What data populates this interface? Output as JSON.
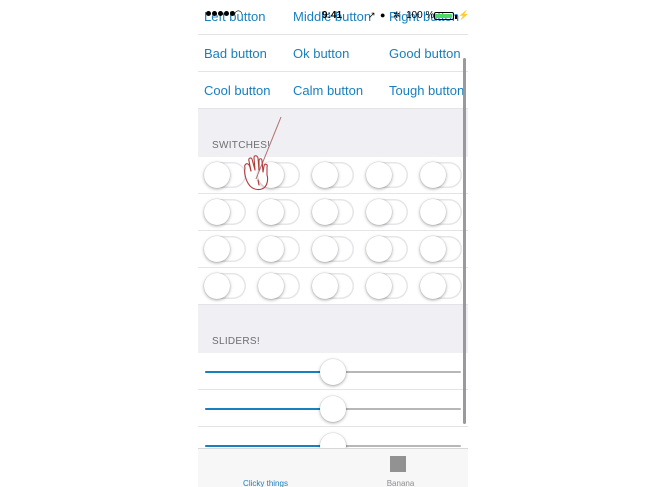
{
  "status_bar": {
    "time": "9:41",
    "battery_percent": "100 %",
    "battery_level": 1.0
  },
  "button_rows": [
    [
      "Left button",
      "Middle button",
      "Right button"
    ],
    [
      "Bad button",
      "Ok button",
      "Good button"
    ],
    [
      "Cool button",
      "Calm button",
      "Tough button"
    ]
  ],
  "switches": {
    "header": "SWITCHES!",
    "rows": 4,
    "columns": 5,
    "all_on": false
  },
  "sliders": {
    "header": "SLIDERS!",
    "values": [
      0.5,
      0.5,
      0.5
    ],
    "accent_color": "#1a7fbd"
  },
  "tab_bar": {
    "tabs": [
      {
        "label": "Clicky things",
        "selected": true
      },
      {
        "label": "Banana",
        "selected": false
      }
    ]
  },
  "colors": {
    "tint": "#1a7fbd",
    "group_background": "#efeff4",
    "separator": "#e3e3e8"
  },
  "icons": [
    "wifi-icon",
    "location-icon",
    "alarm-icon",
    "bluetooth-icon",
    "battery-icon",
    "touch-hand-icon",
    "square-tab-icon"
  ]
}
